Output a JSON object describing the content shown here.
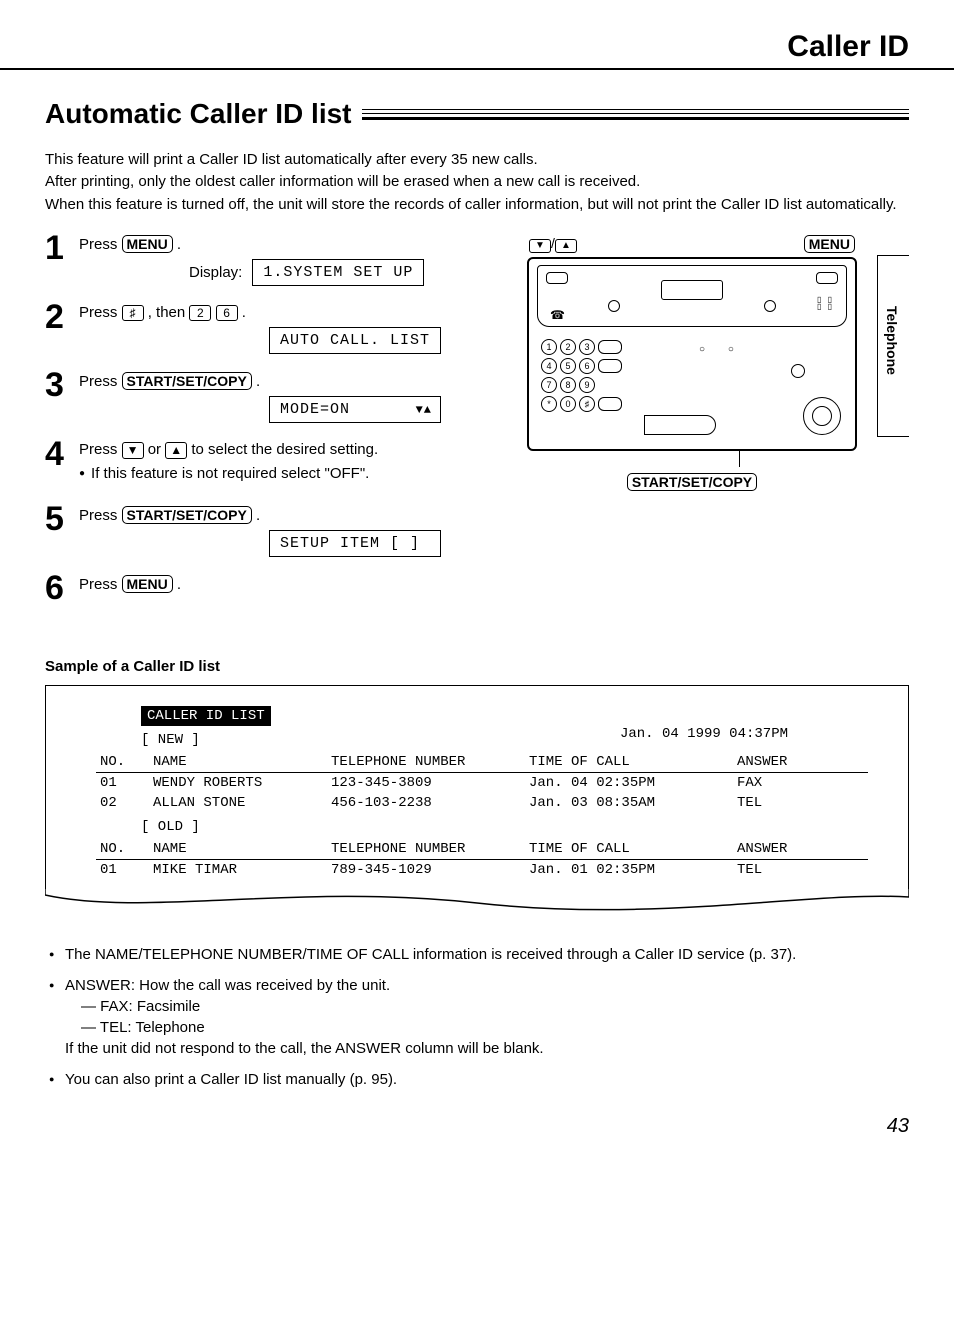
{
  "header": {
    "running_head": "Caller ID"
  },
  "title": "Automatic Caller ID list",
  "intro": [
    "This feature will print a Caller ID list automatically after every 35 new calls.",
    "After printing, only the oldest caller information will be erased when a new call is received.",
    "When this feature is turned off, the unit will store the records of caller information, but will not print the Caller ID list automatically."
  ],
  "steps": [
    {
      "num": "1",
      "text_pre": "Press ",
      "key1": "MENU",
      "text_post": ".",
      "display_label": "Display:",
      "lcd": "1.SYSTEM SET UP"
    },
    {
      "num": "2",
      "text_pre": "Press ",
      "key1": "♯",
      "text_mid": ", then ",
      "key2": "2",
      "key3": "6",
      "text_post": ".",
      "lcd": "AUTO CALL. LIST"
    },
    {
      "num": "3",
      "text_pre": "Press ",
      "key1": "START/SET/COPY",
      "text_post": ".",
      "lcd": "MODE=ON",
      "lcd_arrows": "▼▲"
    },
    {
      "num": "4",
      "text_pre": "Press ",
      "key1": "▼",
      "text_mid": " or ",
      "key2": "▲",
      "text_post": " to select the desired setting.",
      "bullet": "If this feature is not required select \"OFF\"."
    },
    {
      "num": "5",
      "text_pre": "Press ",
      "key1": "START/SET/COPY",
      "text_post": ".",
      "lcd": "SETUP ITEM [  ]"
    },
    {
      "num": "6",
      "text_pre": "Press ",
      "key1": "MENU",
      "text_post": "."
    }
  ],
  "illustration": {
    "top_arrows_1": "▼",
    "top_arrows_sep": "/",
    "top_arrows_2": "▲",
    "top_menu": "MENU",
    "bottom_label": "START/SET/COPY",
    "keypad": [
      "1",
      "2",
      "3",
      "4",
      "5",
      "6",
      "7",
      "8",
      "9",
      "*",
      "0",
      "♯"
    ]
  },
  "side_tab": "Telephone",
  "sample": {
    "heading": "Sample of a Caller ID list",
    "title_inv": "CALLER ID LIST",
    "timestamp": "Jan. 04 1999 04:37PM",
    "new_label": "[ NEW ]",
    "old_label": "[ OLD ]",
    "columns": {
      "no": "NO.",
      "name": "NAME",
      "tel": "TELEPHONE NUMBER",
      "time": "TIME OF CALL",
      "ans": "ANSWER"
    },
    "new_rows": [
      {
        "no": "01",
        "name": "WENDY ROBERTS",
        "tel": "123-345-3809",
        "time": "Jan. 04 02:35PM",
        "ans": "FAX"
      },
      {
        "no": "02",
        "name": "ALLAN STONE",
        "tel": "456-103-2238",
        "time": "Jan. 03 08:35AM",
        "ans": "TEL"
      }
    ],
    "old_rows": [
      {
        "no": "01",
        "name": "MIKE TIMAR",
        "tel": "789-345-1029",
        "time": "Jan. 01 02:35PM",
        "ans": "TEL"
      }
    ]
  },
  "notes": {
    "n1": "The NAME/TELEPHONE NUMBER/TIME OF CALL information is received through a Caller ID service (p. 37).",
    "n2": "ANSWER:  How the call was received by the unit.",
    "n2a": "FAX: Facsimile",
    "n2b": "TEL: Telephone",
    "n2c": "If the unit did not respond to the call, the ANSWER column will be blank.",
    "n3": "You can also print a Caller ID list manually (p. 95)."
  },
  "page_number": "43"
}
